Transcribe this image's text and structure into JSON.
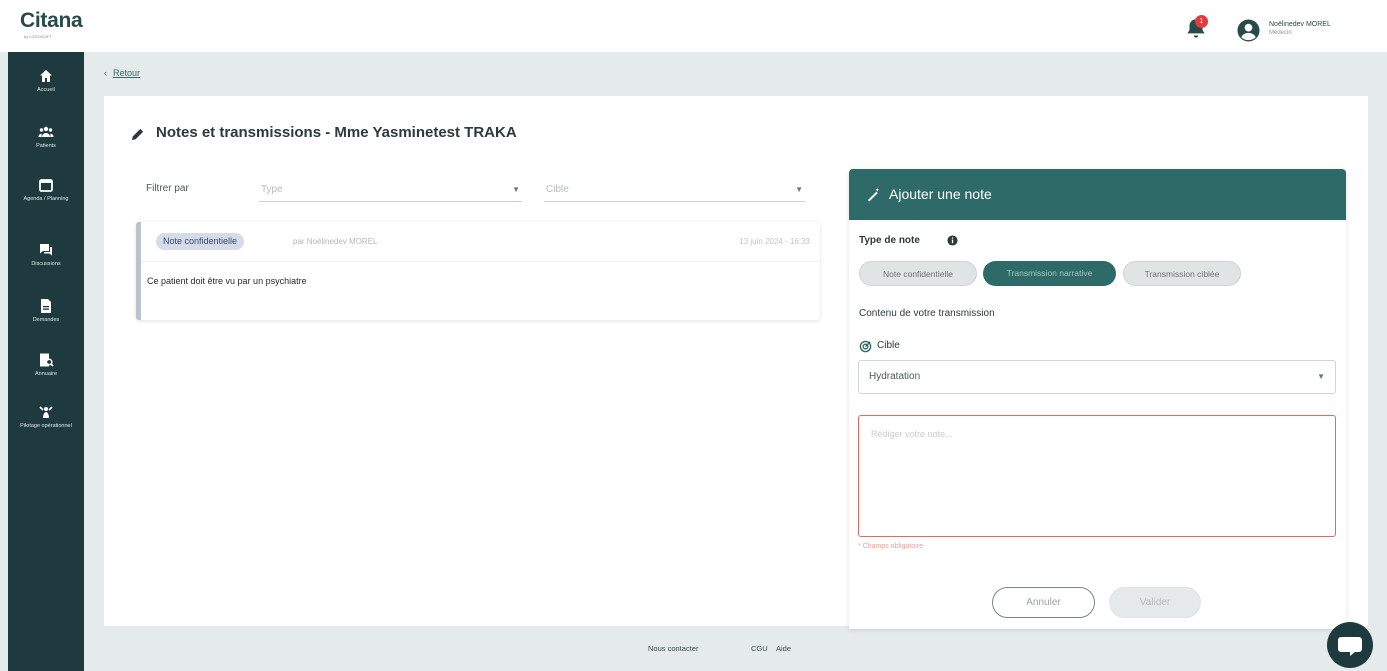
{
  "header": {
    "logo": "Citana",
    "logo_sub": "by LOGOSOFT",
    "notifications_count": "1",
    "user_name": "Noëlinedev MOREL",
    "user_role": "Médecin"
  },
  "sidebar": {
    "items": [
      {
        "label": "Accueil",
        "icon": "home-icon"
      },
      {
        "label": "Patients",
        "icon": "patients-icon"
      },
      {
        "label": "Agenda / Planning",
        "icon": "calendar-icon"
      },
      {
        "label": "Discussions",
        "icon": "chat-icon"
      },
      {
        "label": "Demandes",
        "icon": "document-icon"
      },
      {
        "label": "Annuaire",
        "icon": "directory-icon"
      },
      {
        "label": "Pilotage opérationnel",
        "icon": "steering-icon"
      }
    ]
  },
  "breadcrumb": {
    "back_label": "Retour",
    "arrow": "‹"
  },
  "page": {
    "title": "Notes et transmissions - Mme Yasminetest TRAKA",
    "filter_label": "Filtrer par",
    "filter_type_placeholder": "Type",
    "filter_cible_placeholder": "Cible"
  },
  "notes": [
    {
      "badge": "Note confidentielle",
      "author": "par Noëlinedev MOREL",
      "date": "13 juin 2024 - 16:33",
      "body": "Ce patient doit être vu par un psychiatre"
    }
  ],
  "add_note": {
    "title": "Ajouter une note",
    "type_label": "Type de note",
    "chips": [
      "Note confidentielle",
      "Transmission narrative",
      "Transmission ciblée"
    ],
    "selected_chip": "Transmission narrative",
    "content_label": "Contenu de votre transmission",
    "cible_label": "Cible",
    "cible_value": "Hydratation",
    "textarea_placeholder": "Rédiger votre note...",
    "required_msg": "* Champs obligatoire",
    "cancel_label": "Annuler",
    "validate_label": "Valider"
  },
  "footer": {
    "contact": "Nous contacter",
    "cgu": "CGU",
    "help": "Aide"
  },
  "colors": {
    "sidebar_bg": "#1f3a3e",
    "accent": "#2e6b68",
    "error": "#e3695e",
    "badge_bg": "#d5dbe8"
  }
}
